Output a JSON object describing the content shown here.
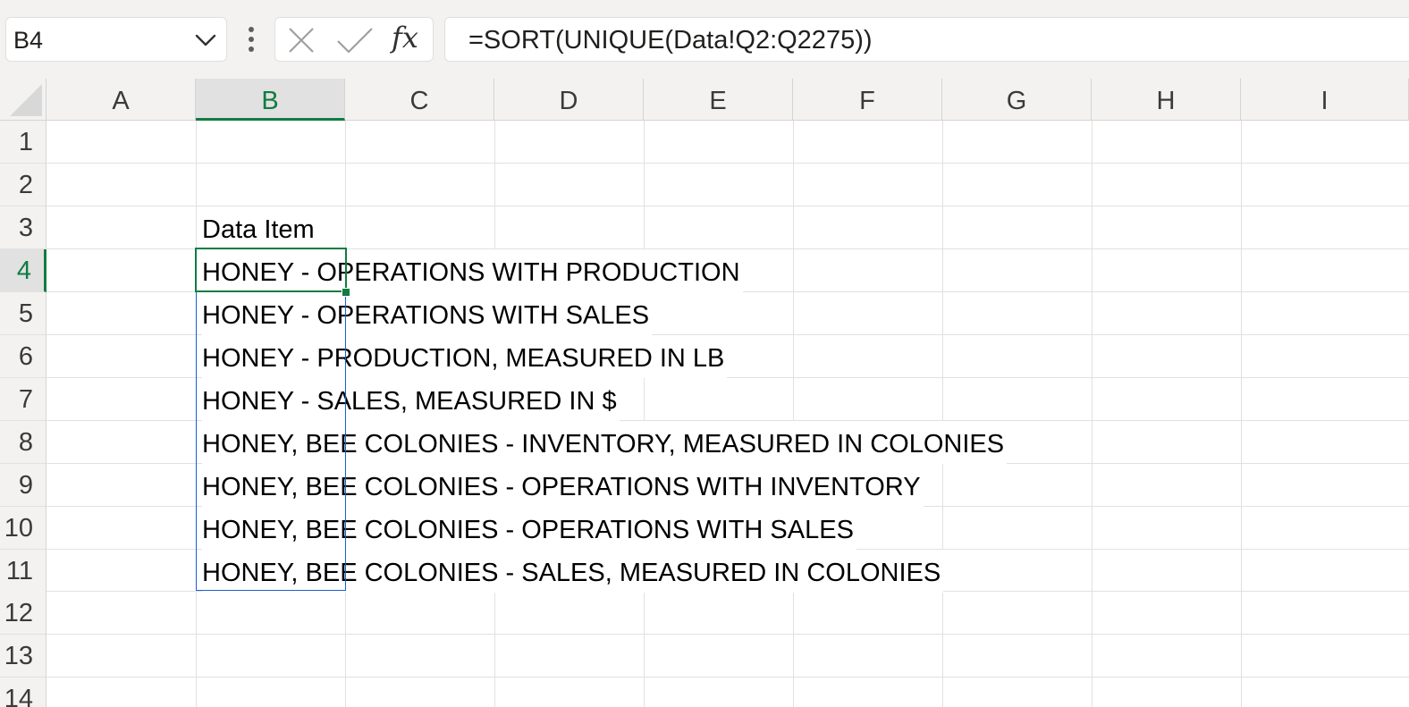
{
  "formula_bar": {
    "name_box": "B4",
    "formula": "=SORT(UNIQUE(Data!Q2:Q2275))",
    "fx_label": "fx",
    "icons": [
      "chevron-down-icon",
      "more-vertical-icon",
      "cancel-icon",
      "enter-icon",
      "fx-icon"
    ]
  },
  "columns": [
    "A",
    "B",
    "C",
    "D",
    "E",
    "F",
    "G",
    "H",
    "I"
  ],
  "rows": [
    "1",
    "2",
    "3",
    "4",
    "5",
    "6",
    "7",
    "8",
    "9",
    "10",
    "11",
    "12",
    "13",
    "14"
  ],
  "active_cell": {
    "column": "B",
    "row": "4"
  },
  "selection": "B4:B11",
  "cells": {
    "B3": "Data Item",
    "B4": "HONEY - OPERATIONS WITH PRODUCTION",
    "B5": "HONEY - OPERATIONS WITH SALES",
    "B6": "HONEY - PRODUCTION, MEASURED IN LB",
    "B7": "HONEY - SALES, MEASURED IN $",
    "B8": "HONEY, BEE COLONIES - INVENTORY, MEASURED IN COLONIES",
    "B9": "HONEY, BEE COLONIES - OPERATIONS WITH INVENTORY",
    "B10": "HONEY, BEE COLONIES - OPERATIONS WITH SALES",
    "B11": "HONEY, BEE COLONIES - SALES, MEASURED IN COLONIES"
  },
  "colors": {
    "accent_green": "#107c41",
    "selection_blue": "#1a5fd0",
    "header_bg": "#f3f2f1",
    "gridline": "#e1e1e1"
  }
}
